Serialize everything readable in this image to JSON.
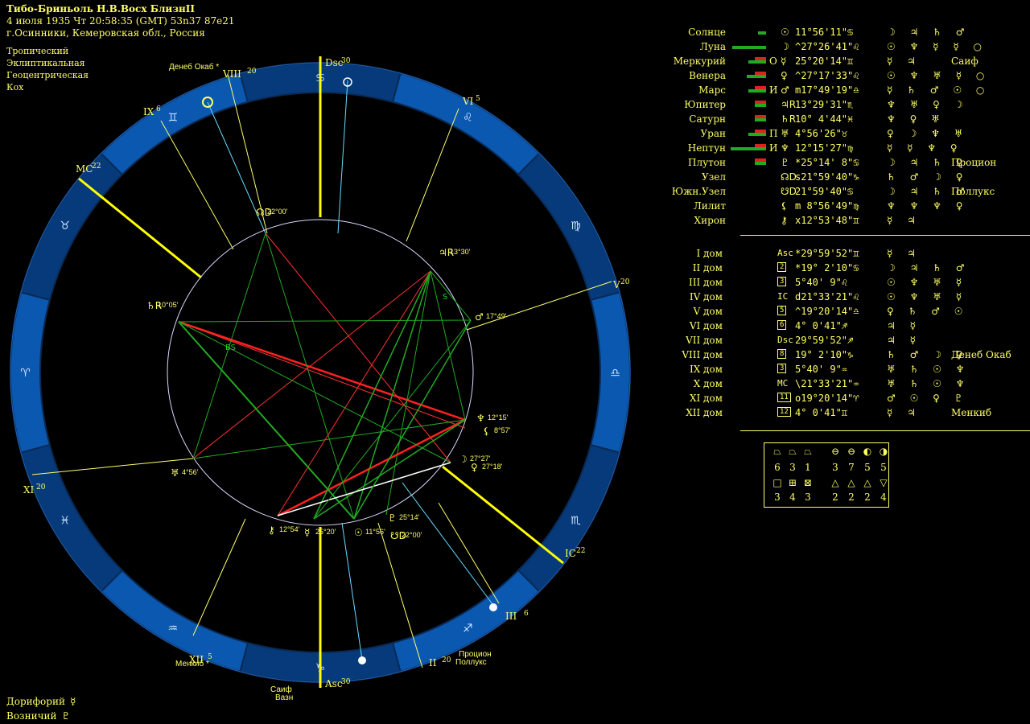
{
  "header": {
    "title": "Тибо-Бриньоль Н.В.Восх БлизнII",
    "datetime": "4 июля 1935  Чт  20:58:35 (GMT) 53n37  87e21",
    "place": "г.Осинники, Кемеровская обл., Россия"
  },
  "options": [
    "Тропический",
    "Эклиптикальная",
    "Геоцентрическая",
    "Кох"
  ],
  "footer": [
    {
      "label": "Дорифорий",
      "glyph": "☿"
    },
    {
      "label": "Возничий",
      "glyph": "♇"
    }
  ],
  "planets": [
    {
      "name": "Солнце",
      "glyph": "☉",
      "deg": "11°56'11\"",
      "sign": "♋",
      "aspects": "☽ ♃ ♄ ♂",
      "star": ""
    },
    {
      "name": "Луна",
      "glyph": "☽",
      "deg": "^27°26'41\"",
      "sign": "♌",
      "aspects": "☉ ♆ ☿ ☿ ○",
      "star": ""
    },
    {
      "name": "Меркурий",
      "glyph": "☿",
      "deg": "25°20'14\"",
      "sign": "♊",
      "aspects": "☿   ♃",
      "star": "Саиф",
      "prefix": "О"
    },
    {
      "name": "Венера",
      "glyph": "♀",
      "deg": "^27°17'33\"",
      "sign": "♌",
      "aspects": "☉ ♆ ♅ ☿ ○",
      "star": ""
    },
    {
      "name": "Марс",
      "glyph": "♂",
      "deg": "m17°49'19\"",
      "sign": "♎",
      "aspects": "☿ ♄ ♂ ☉ ○",
      "star": "",
      "prefix": "И"
    },
    {
      "name": "Юпитер",
      "glyph": "♃R",
      "deg": "13°29'31\"",
      "sign": "♏",
      "aspects": "♆ ♅ ♀ ☽",
      "star": ""
    },
    {
      "name": "Сатурн",
      "glyph": "♄R",
      "deg": "10° 4'44\"",
      "sign": "♓",
      "aspects": "♆ ♀ ♅",
      "star": ""
    },
    {
      "name": "Уран",
      "glyph": "♅",
      "deg": "4°56'26\"",
      "sign": "♉",
      "aspects": "♀ ☽ ♆ ♅",
      "star": "",
      "prefix": "П"
    },
    {
      "name": "Нептун",
      "glyph": "♆",
      "deg": "12°15'27\"",
      "sign": "♍",
      "aspects": "☿ ☿ ♆ ♀",
      "star": "",
      "prefix": "И"
    },
    {
      "name": "Плутон",
      "glyph": "♇",
      "deg": "*25°14' 8\"",
      "sign": "♋",
      "aspects": "☽ ♃ ♄ ♀",
      "star": "Процион"
    },
    {
      "name": "Узел",
      "glyph": "☊D",
      "deg": "s21°59'40\"",
      "sign": "♑",
      "aspects": "♄ ♂ ☽ ♀",
      "star": ""
    },
    {
      "name": "Южн.Узел",
      "glyph": "☋D",
      "deg": "21°59'40\"",
      "sign": "♋",
      "aspects": "☽ ♃ ♄ ♂",
      "star": "Поллукс"
    },
    {
      "name": "Лилит",
      "glyph": "⚸",
      "deg": "m 8°56'49\"",
      "sign": "♍",
      "aspects": "♆ ♆ ♆ ♀",
      "star": ""
    },
    {
      "name": "Хирон",
      "glyph": "⚷",
      "deg": "x12°53'48\"",
      "sign": "♊",
      "aspects": "☿   ♃",
      "star": ""
    }
  ],
  "houses": [
    {
      "name": "I дом",
      "code": "Asc",
      "deg": "*29°59'52\"",
      "sign": "♊",
      "aspects": "☿   ♃",
      "star": ""
    },
    {
      "name": "II дом",
      "code": "2",
      "deg": "*19° 2'10\"",
      "sign": "♋",
      "aspects": "☽ ♃ ♄ ♂",
      "star": ""
    },
    {
      "name": "III дом",
      "code": "3",
      "deg": "5°40' 9\"",
      "sign": "♌",
      "aspects": "☉ ♆ ♅ ☿",
      "star": ""
    },
    {
      "name": "IV дом",
      "code": "IC",
      "deg": "d21°33'21\"",
      "sign": "♌",
      "aspects": "☉ ♆ ♅ ☿",
      "star": ""
    },
    {
      "name": "V дом",
      "code": "5",
      "deg": "^19°20'14\"",
      "sign": "♎",
      "aspects": "♀   ♄ ♂ ☉",
      "star": ""
    },
    {
      "name": "VI дом",
      "code": "6",
      "deg": "4° 0'41\"",
      "sign": "♐",
      "aspects": "♃   ☿",
      "star": ""
    },
    {
      "name": "VII дом",
      "code": "Dsc",
      "deg": "29°59'52\"",
      "sign": "♐",
      "aspects": "♃   ☿",
      "star": ""
    },
    {
      "name": "VIII дом",
      "code": "8",
      "deg": "19° 2'10\"",
      "sign": "♑",
      "aspects": "♄ ♂ ☽ ♀",
      "star": "Денеб Окаб"
    },
    {
      "name": "IX дом",
      "code": "3",
      "deg": "5°40' 9\"",
      "sign": "♒",
      "aspects": "♅ ♄ ☉ ♆",
      "star": ""
    },
    {
      "name": "X дом",
      "code": "MC",
      "deg": "\\21°33'21\"",
      "sign": "♒",
      "aspects": "♅ ♄ ☉ ♆",
      "star": ""
    },
    {
      "name": "XI дом",
      "code": "11",
      "deg": "о19°20'14\"",
      "sign": "♈",
      "aspects": "♂ ☉ ♀ ♇",
      "star": ""
    },
    {
      "name": "XII дом",
      "code": "12",
      "deg": "4° 0'41\"",
      "sign": "♊",
      "aspects": "☿   ♃",
      "star": "Менкиб"
    }
  ],
  "elements_box": {
    "row1_numbers": [
      "6",
      "3",
      "1",
      "3",
      "7",
      "5",
      "5"
    ],
    "row2_numbers": [
      "3",
      "4",
      "3",
      "2",
      "2",
      "2",
      "4"
    ]
  },
  "wheel": {
    "angles": {
      "asc": "Asc",
      "asc_deg": "30",
      "dsc": "Dsc",
      "dsc_deg": "30",
      "mc": "MC",
      "mc_deg": "22",
      "ic": "IC",
      "ic_deg": "22"
    },
    "house_labels": [
      {
        "t": "VIII",
        "d": "20"
      },
      {
        "t": "VI",
        "d": "5"
      },
      {
        "t": "IX",
        "d": "6"
      },
      {
        "t": "V",
        "d": "20"
      },
      {
        "t": "XI",
        "d": "20"
      },
      {
        "t": "III",
        "d": "6"
      },
      {
        "t": "XII",
        "d": "5"
      },
      {
        "t": "II",
        "d": "20"
      }
    ],
    "stars": [
      "Денеб Окаб",
      "Менкиб",
      "Саиф",
      "Вазн",
      "Процион",
      "Поллукс"
    ],
    "planet_positions": [
      {
        "g": "☊D",
        "d": "22°00'"
      },
      {
        "g": "♃R",
        "d": "13°30'"
      },
      {
        "g": "♂",
        "d": "17°49'"
      },
      {
        "g": "♄R",
        "d": "10°05'"
      },
      {
        "g": "♆",
        "d": "12°15'"
      },
      {
        "g": "⚸",
        "d": "8°57'"
      },
      {
        "g": "☽",
        "d": "27°27'"
      },
      {
        "g": "♀",
        "d": "27°18'"
      },
      {
        "g": "♅",
        "d": "4°56'"
      },
      {
        "g": "⚷",
        "d": "12°54'"
      },
      {
        "g": "☿",
        "d": "25°20'"
      },
      {
        "g": "☉",
        "d": "11°56'"
      },
      {
        "g": "♇",
        "d": "25°14'"
      },
      {
        "g": "☋D",
        "d": "22°00'"
      }
    ],
    "aspect_labels": [
      "BS",
      "S"
    ]
  }
}
